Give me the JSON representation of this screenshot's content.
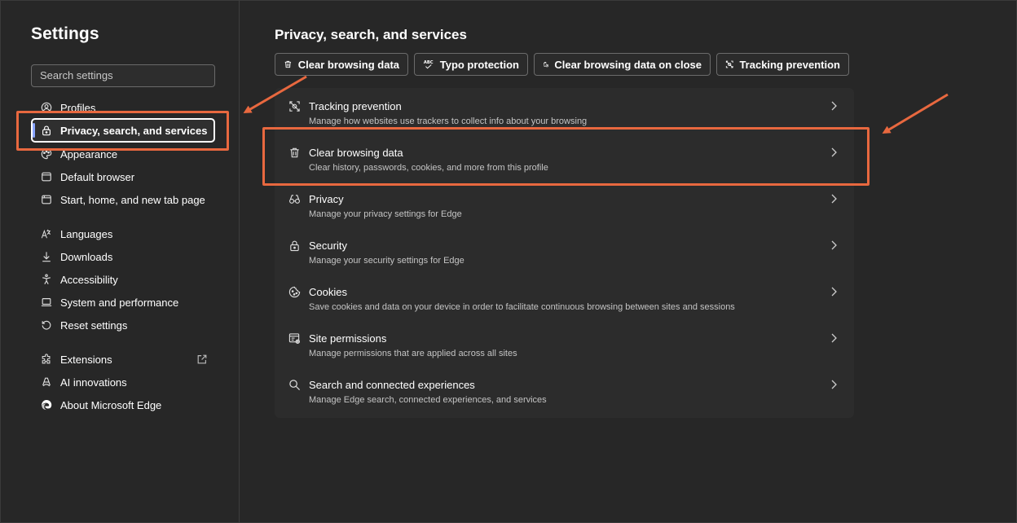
{
  "sidebar": {
    "title": "Settings",
    "search_placeholder": "Search settings",
    "items": [
      {
        "label": "Profiles",
        "icon": "profile-icon"
      },
      {
        "label": "Privacy, search, and services",
        "icon": "lock-icon",
        "active": true
      },
      {
        "label": "Appearance",
        "icon": "palette-icon"
      },
      {
        "label": "Default browser",
        "icon": "browser-icon"
      },
      {
        "label": "Start, home, and new tab page",
        "icon": "home-tab-icon"
      },
      {
        "label": "Languages",
        "icon": "languages-icon"
      },
      {
        "label": "Downloads",
        "icon": "download-icon"
      },
      {
        "label": "Accessibility",
        "icon": "accessibility-icon"
      },
      {
        "label": "System and performance",
        "icon": "laptop-icon"
      },
      {
        "label": "Reset settings",
        "icon": "reset-icon"
      },
      {
        "label": "Extensions",
        "icon": "puzzle-icon"
      },
      {
        "label": "AI innovations",
        "icon": "ai-icon"
      },
      {
        "label": "About Microsoft Edge",
        "icon": "edge-logo-icon"
      }
    ]
  },
  "main": {
    "title": "Privacy, search, and services",
    "chips": [
      {
        "label": "Clear browsing data",
        "icon": "trash-icon"
      },
      {
        "label": "Typo protection",
        "icon": "spellcheck-icon"
      },
      {
        "label": "Clear browsing data on close",
        "icon": "trash-clock-icon"
      },
      {
        "label": "Tracking prevention",
        "icon": "tracking-icon"
      }
    ],
    "rows": [
      {
        "title": "Tracking prevention",
        "desc": "Manage how websites use trackers to collect info about your browsing",
        "icon": "tracking-icon"
      },
      {
        "title": "Clear browsing data",
        "desc": "Clear history, passwords, cookies, and more from this profile",
        "icon": "trash-icon"
      },
      {
        "title": "Privacy",
        "desc": "Manage your privacy settings for Edge",
        "icon": "glasses-icon"
      },
      {
        "title": "Security",
        "desc": "Manage your security settings for Edge",
        "icon": "lock-icon"
      },
      {
        "title": "Cookies",
        "desc": "Save cookies and data on your device in order to facilitate continuous browsing between sites and sessions",
        "icon": "cookie-icon"
      },
      {
        "title": "Site permissions",
        "desc": "Manage permissions that are applied across all sites",
        "icon": "site-permissions-icon"
      },
      {
        "title": "Search and connected experiences",
        "desc": "Manage Edge search, connected experiences, and services",
        "icon": "search-icon"
      }
    ]
  },
  "colors": {
    "accent": "#8aa6ff",
    "annotation": "#e8683f",
    "background": "#272727",
    "card": "#2c2c2c"
  }
}
